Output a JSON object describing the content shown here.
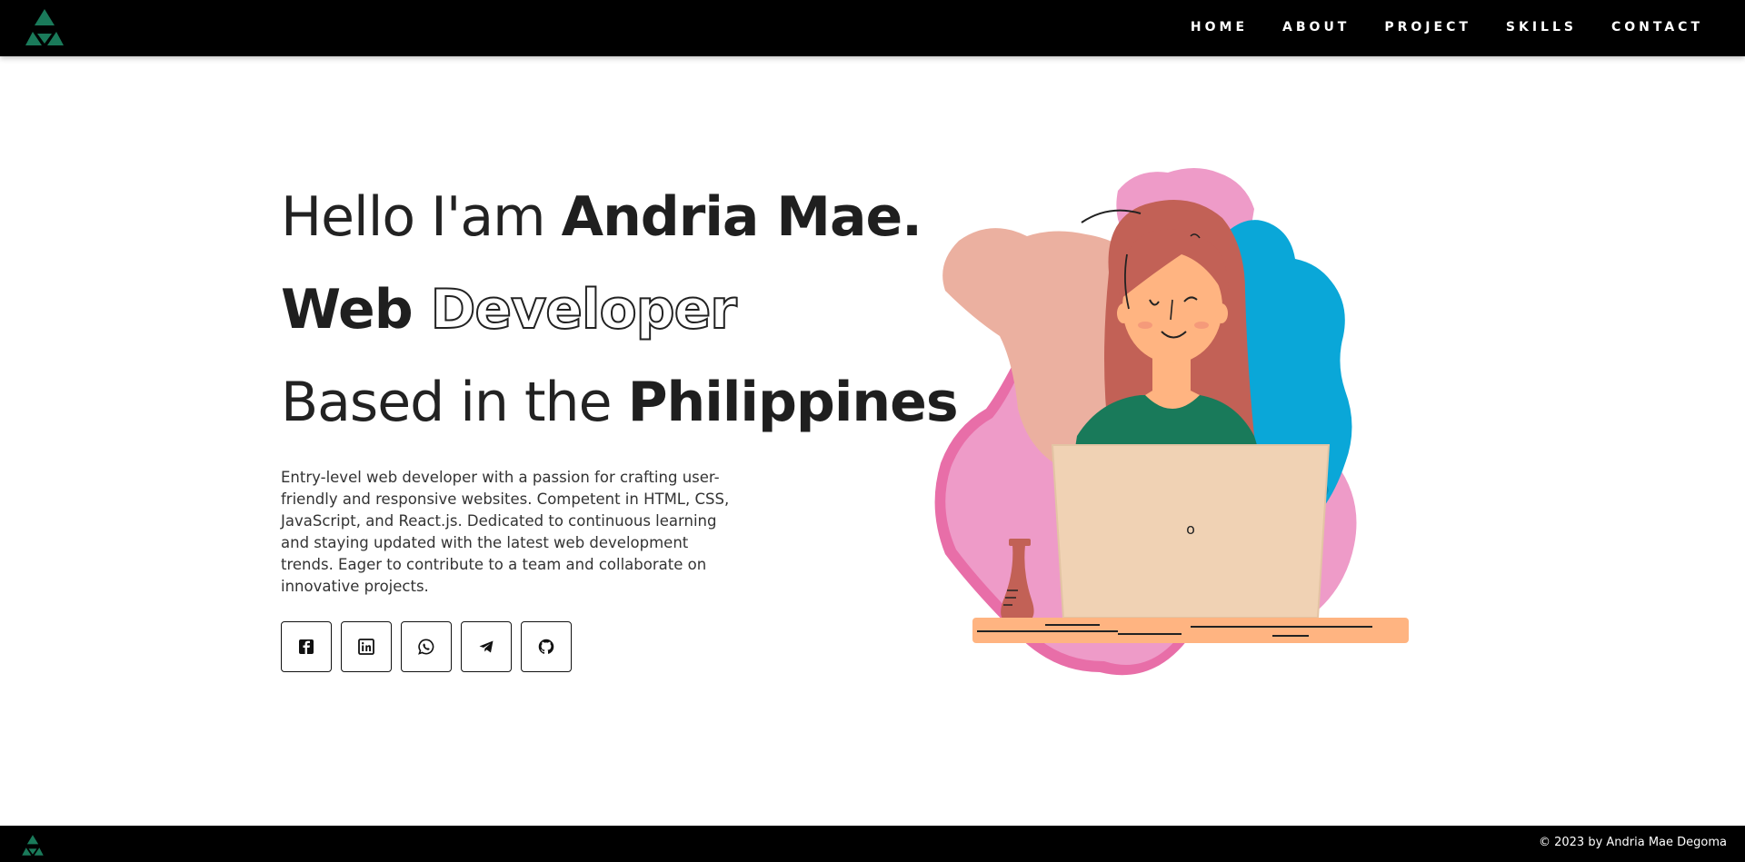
{
  "header": {
    "logo": "logo-icon",
    "nav": [
      "HOME",
      "ABOUT",
      "PROJECT",
      "SKILLS",
      "CONTACT"
    ]
  },
  "hero": {
    "line1": {
      "light": "Hello I'am ",
      "bold": "Andria Mae."
    },
    "line2": {
      "bold": "Web ",
      "outline": "Developer"
    },
    "line3": {
      "light": "Based in the ",
      "bold": "Philippines"
    },
    "description": "Entry-level web developer with a passion for crafting user-friendly and responsive websites. Competent in HTML, CSS, JavaScript, and React.js. Dedicated to continuous learning and staying updated with the latest web development trends. Eager to contribute to a team and collaborate on innovative projects.",
    "socials": [
      "facebook-icon",
      "linkedin-icon",
      "whatsapp-icon",
      "telegram-icon",
      "github-icon"
    ]
  },
  "illustration": {
    "laptop_letter": "o"
  },
  "footer": {
    "copyright": "© 2023 by Andria Mae Degoma"
  },
  "colors": {
    "accent": "#1a7a5a",
    "header_bg": "#000000",
    "text": "#222222",
    "blob_pink": "#ee9bc8",
    "blob_blue": "#0aa7d8",
    "blob_peach": "#ebb0a0"
  }
}
